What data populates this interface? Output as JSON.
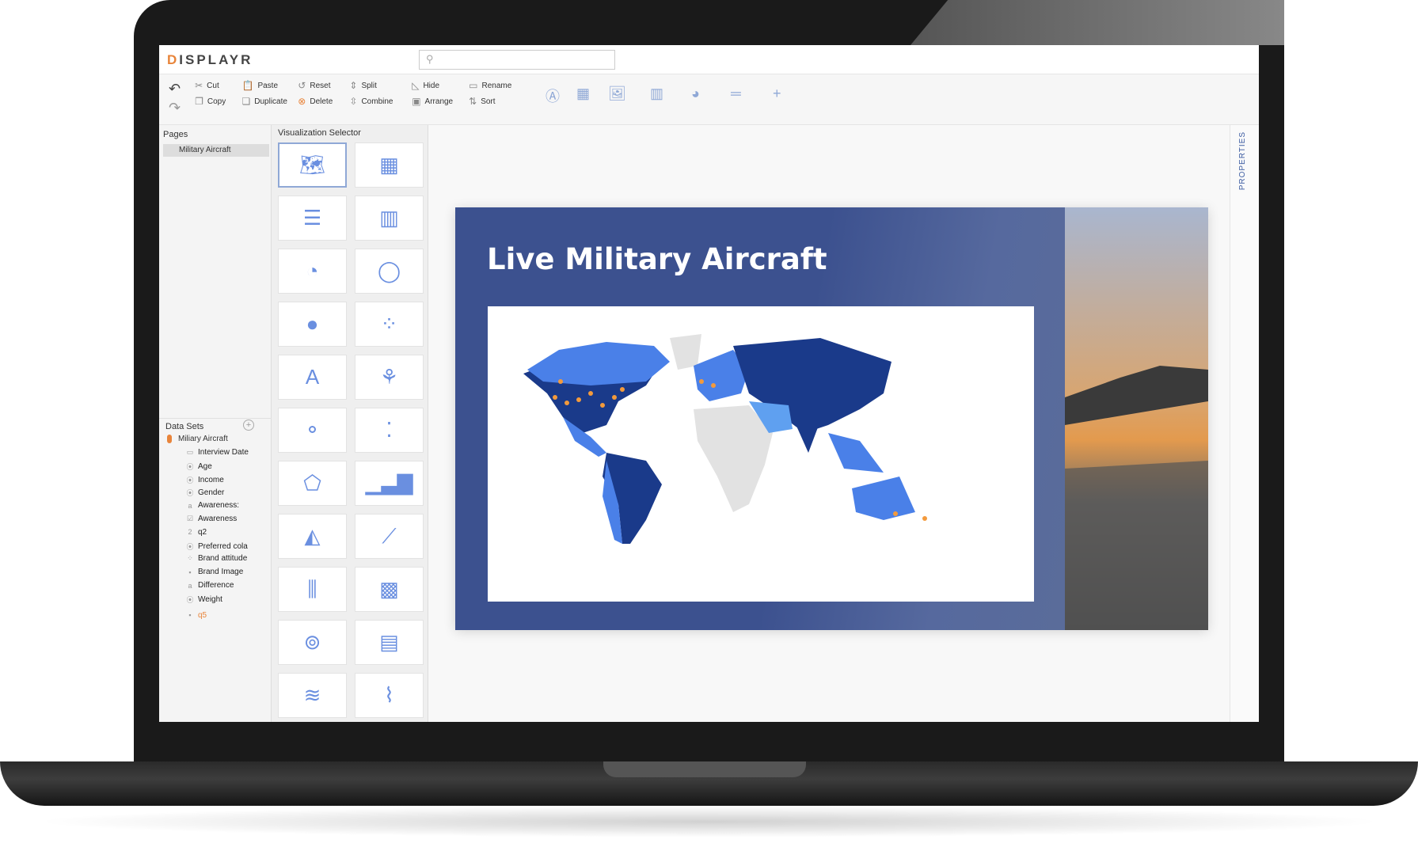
{
  "app": {
    "logo": "DISPLAYR",
    "search_placeholder": ""
  },
  "toolbar": {
    "undo": "undo",
    "redo": "redo",
    "row1": [
      {
        "label": "Cut",
        "icon": "scissors-icon"
      },
      {
        "label": "Paste",
        "icon": "clipboard-icon"
      },
      {
        "label": "Reset",
        "icon": "reset-icon"
      },
      {
        "label": "Split",
        "icon": "split-icon"
      },
      {
        "label": "Hide",
        "icon": "hide-icon"
      },
      {
        "label": "Rename",
        "icon": "rename-icon"
      }
    ],
    "row2": [
      {
        "label": "Copy",
        "icon": "copy-icon"
      },
      {
        "label": "Duplicate",
        "icon": "duplicate-icon"
      },
      {
        "label": "Delete",
        "icon": "delete-icon"
      },
      {
        "label": "Combine",
        "icon": "combine-icon"
      },
      {
        "label": "Arrange",
        "icon": "arrange-icon"
      },
      {
        "label": "Sort",
        "icon": "sort-icon"
      }
    ],
    "insert_icons": [
      "text-box-icon",
      "table-icon",
      "image-icon",
      "chart-icon",
      "shape-icon",
      "equals-icon",
      "plus-icon"
    ]
  },
  "pages": {
    "header": "Pages",
    "items": [
      "Military Aircraft"
    ]
  },
  "viz": {
    "header": "Visualization Selector",
    "thumbnails": [
      "geographic-map",
      "small-multiples-map",
      "bar-chart",
      "column-chart",
      "pie-chart",
      "donut-chart",
      "pictograph",
      "pictograph-bar",
      "word-cloud",
      "palm-tree",
      "bubble-chart",
      "scatterplot",
      "radar-chart",
      "histogram",
      "area-chart",
      "line-chart",
      "box-plot",
      "heatmap",
      "venn-diagram",
      "mosaic",
      "streamgraph",
      "density-plot"
    ]
  },
  "datasets": {
    "header": "Data Sets",
    "name": "Miliary Aircraft",
    "items": [
      {
        "label": "Interview Date",
        "icon": "calendar-icon"
      },
      {
        "label": "Age",
        "icon": "radio-icon"
      },
      {
        "label": "Income",
        "icon": "radio-icon"
      },
      {
        "label": "Gender",
        "icon": "radio-icon"
      },
      {
        "label": "Awareness:",
        "icon": "text-icon"
      },
      {
        "label": "Awareness",
        "icon": "checkbox-icon"
      },
      {
        "label": "q2",
        "icon": "number-grid-icon"
      },
      {
        "label": "Preferred cola",
        "icon": "radio-icon"
      },
      {
        "label": "Brand attitude",
        "icon": "radio-grid-icon"
      },
      {
        "label": "Brand Image",
        "icon": "checkbox-grid-icon"
      },
      {
        "label": "Difference",
        "icon": "text-icon"
      },
      {
        "label": "Weight",
        "icon": "radio-icon"
      },
      {
        "label": "q5",
        "icon": "grid-icon",
        "highlight": true
      }
    ]
  },
  "properties": {
    "label": "PROPERTIES"
  },
  "slide": {
    "title": "Live Military Aircraft"
  },
  "colors": {
    "accent": "#e8843a",
    "slide_bg": "#3c518f",
    "map_dark": "#1a3a8a",
    "map_mid": "#4a80e8",
    "map_light": "#5fa0f0",
    "map_na": "#e2e2e2",
    "marker": "#f39a3c"
  }
}
